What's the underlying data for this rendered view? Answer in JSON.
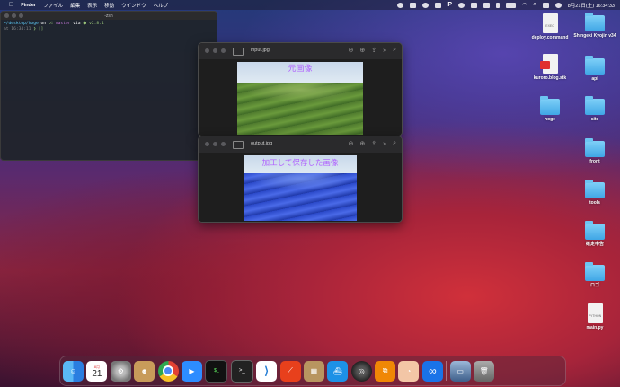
{
  "menubar": {
    "app_name": "Finder",
    "items": [
      "ファイル",
      "編集",
      "表示",
      "移動",
      "ウインドウ",
      "ヘルプ"
    ],
    "clock": "8月21日(土) 16:34:33"
  },
  "terminal": {
    "title": "-zsh",
    "line1_path": "~/desktop/hoge",
    "line1_on": " on ",
    "line1_git": "master",
    "line1_via": " via ",
    "line1_node": "v2.8.1",
    "line2_time": "at 16:34:11",
    "line2_prompt": "❯ []"
  },
  "preview_input": {
    "title": "input.jpg",
    "caption": "元画像"
  },
  "preview_output": {
    "title": "output.jpg",
    "caption": "加工して保存した画像"
  },
  "desktop": {
    "items": [
      {
        "label": "deploy.command",
        "kind": "doc",
        "ext": "EXEC"
      },
      {
        "label": "Shingeki Kyojin v34",
        "kind": "folder"
      },
      {
        "label": "kuroro.blog.stk",
        "kind": "doc-red",
        "ext": ""
      },
      {
        "label": "api",
        "kind": "folder"
      },
      {
        "label": "hoge",
        "kind": "folder"
      },
      {
        "label": "site",
        "kind": "folder"
      },
      {
        "label": "front",
        "kind": "folder"
      },
      {
        "label": "tools",
        "kind": "folder"
      },
      {
        "label": "確定申告",
        "kind": "folder"
      },
      {
        "label": "ロゴ",
        "kind": "folder"
      },
      {
        "label": "main.py",
        "kind": "doc",
        "ext": "PYTHON"
      }
    ]
  },
  "dock": {
    "calendar_month": "8月",
    "calendar_day": "21",
    "apps": [
      "finder",
      "calendar",
      "system-preferences",
      "contacts",
      "chrome",
      "zoom",
      "activity-monitor",
      "terminal",
      "vscode",
      "instruments",
      "archive-utility",
      "docker",
      "disk-utility",
      "drawio",
      "preview",
      "infinity",
      "screenshot-app",
      "trash"
    ]
  }
}
